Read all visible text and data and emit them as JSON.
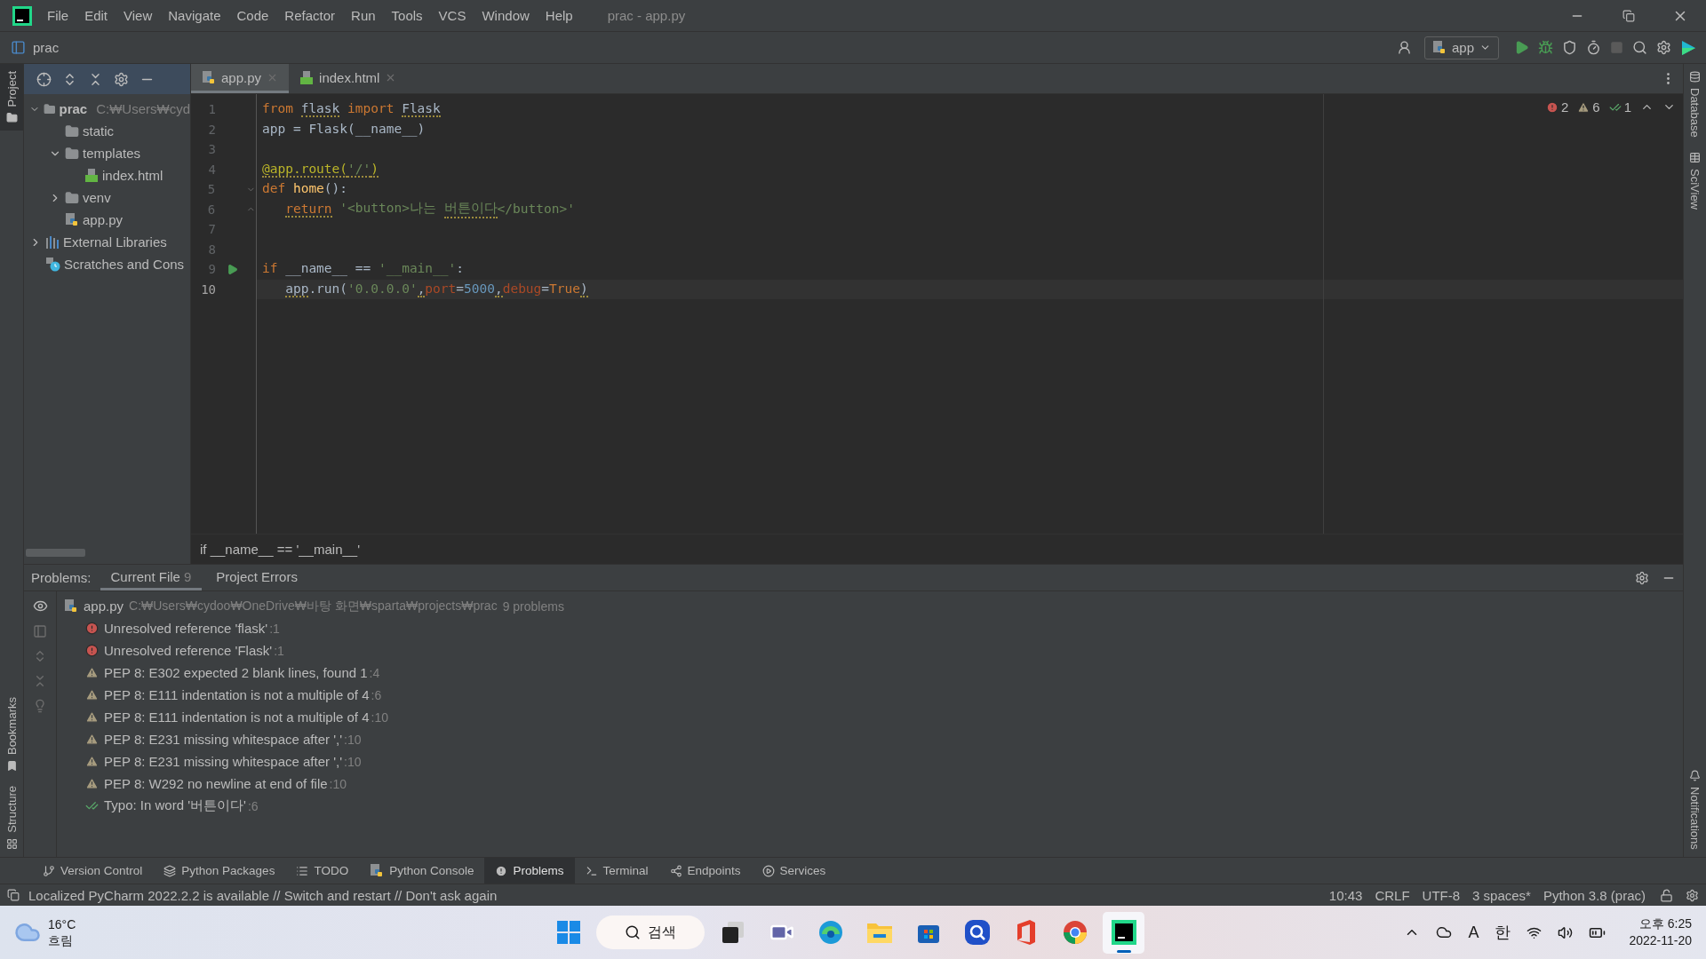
{
  "title_bar": {
    "menu": [
      "File",
      "Edit",
      "View",
      "Navigate",
      "Code",
      "Refactor",
      "Run",
      "Tools",
      "VCS",
      "Window",
      "Help"
    ],
    "title": "prac - app.py"
  },
  "nav_bar": {
    "breadcrumb": "prac",
    "run_config": "app"
  },
  "left_stripe": {
    "top": [
      {
        "label": "Project",
        "selected": true
      }
    ],
    "bottom": [
      {
        "label": "Bookmarks",
        "selected": false
      },
      {
        "label": "Structure",
        "selected": false
      }
    ]
  },
  "right_stripe": {
    "top": [
      {
        "label": "Database"
      },
      {
        "label": "SciView"
      }
    ],
    "bottom": [
      {
        "label": "Notifications"
      }
    ]
  },
  "project_tree": [
    {
      "name": "prac",
      "hint": "C:₩Users₩cyd",
      "kind": "root",
      "expanded": true,
      "children": [
        {
          "name": "static",
          "kind": "folder"
        },
        {
          "name": "templates",
          "kind": "folder",
          "expanded": true,
          "children": [
            {
              "name": "index.html",
              "kind": "html"
            }
          ]
        },
        {
          "name": "venv",
          "kind": "folder",
          "expanded": false
        },
        {
          "name": "app.py",
          "kind": "py"
        }
      ]
    },
    {
      "name": "External Libraries",
      "kind": "libraries",
      "expanded": false
    },
    {
      "name": "Scratches and Cons",
      "kind": "scratches"
    }
  ],
  "editor_tabs": [
    {
      "label": "app.py",
      "kind": "py",
      "selected": true
    },
    {
      "label": "index.html",
      "kind": "html",
      "selected": false
    }
  ],
  "inspections": {
    "errors": "2",
    "warnings": "6",
    "typos": "1"
  },
  "code_lines": [
    {
      "number": "1",
      "tokens": [
        {
          "t": "from ",
          "kind": "kw"
        },
        {
          "t": "flask",
          "kind": "plain",
          "flagged": true
        },
        {
          "t": " import ",
          "kind": "kw"
        },
        {
          "t": "Flask",
          "kind": "plain",
          "flagged": true
        }
      ]
    },
    {
      "number": "2",
      "tokens": [
        {
          "t": "app = Flask(__name__)",
          "kind": "plain"
        }
      ]
    },
    {
      "number": "3"
    },
    {
      "number": "4",
      "tokens": [
        {
          "t": "@app.route(",
          "kind": "deco",
          "flagged": true
        },
        {
          "t": "'/'",
          "kind": "str",
          "flagged": true
        },
        {
          "t": ")",
          "kind": "deco",
          "flagged": true
        }
      ]
    },
    {
      "number": "5",
      "fold_start": true,
      "tokens": [
        {
          "t": "def ",
          "kind": "kw"
        },
        {
          "t": "home",
          "kind": "fn"
        },
        {
          "t": "():",
          "kind": "plain"
        }
      ]
    },
    {
      "number": "6",
      "fold_end": true,
      "indent": true,
      "tokens": [
        {
          "t": "return",
          "kind": "kw",
          "flagged": true
        },
        {
          "t": " '<button>나는 ",
          "kind": "str"
        },
        {
          "t": "버튼이다",
          "kind": "str",
          "flagged": true
        },
        {
          "t": "</button>'",
          "kind": "str"
        }
      ]
    },
    {
      "number": "7"
    },
    {
      "number": "8"
    },
    {
      "number": "9",
      "run": true,
      "tokens": [
        {
          "t": "if ",
          "kind": "kw"
        },
        {
          "t": "__name__ == ",
          "kind": "plain"
        },
        {
          "t": "'__main__'",
          "kind": "str"
        },
        {
          "t": ":",
          "kind": "plain"
        }
      ]
    },
    {
      "number": "10",
      "current": true,
      "indent": true,
      "tokens": [
        {
          "t": "app",
          "kind": "plain",
          "flagged": true
        },
        {
          "t": ".run(",
          "kind": "plain"
        },
        {
          "t": "'0.0.0.0'",
          "kind": "str"
        },
        {
          "t": ",",
          "kind": "plain",
          "flagged": true
        },
        {
          "t": "port",
          "kind": "param"
        },
        {
          "t": "=",
          "kind": "plain"
        },
        {
          "t": "5000",
          "kind": "num"
        },
        {
          "t": ",",
          "kind": "plain",
          "flagged": true
        },
        {
          "t": "debug",
          "kind": "param"
        },
        {
          "t": "=",
          "kind": "plain"
        },
        {
          "t": "True",
          "kind": "kw"
        },
        {
          "t": ")",
          "kind": "plain",
          "flagged": true
        }
      ]
    }
  ],
  "editor_breadcrumb": "if __name__ == '__main__'",
  "problems": {
    "label": "Problems:",
    "tabs": [
      {
        "label": "Current File",
        "count": "9",
        "selected": true
      },
      {
        "label": "Project Errors",
        "selected": false
      }
    ],
    "file": {
      "name": "app.py",
      "path": "C:₩Users₩cydoo₩OneDrive₩바탕 화면₩sparta₩projects₩prac",
      "summary": "9 problems"
    },
    "items": [
      {
        "kind": "error",
        "text": "Unresolved reference 'flask'",
        "line": ":1"
      },
      {
        "kind": "error",
        "text": "Unresolved reference 'Flask'",
        "line": ":1"
      },
      {
        "kind": "warning",
        "text": "PEP 8: E302 expected 2 blank lines, found 1",
        "line": ":4"
      },
      {
        "kind": "warning",
        "text": "PEP 8: E111 indentation is not a multiple of 4",
        "line": ":6"
      },
      {
        "kind": "warning",
        "text": "PEP 8: E111 indentation is not a multiple of 4",
        "line": ":10"
      },
      {
        "kind": "warning",
        "text": "PEP 8: E231 missing whitespace after ','",
        "line": ":10"
      },
      {
        "kind": "warning",
        "text": "PEP 8: E231 missing whitespace after ','",
        "line": ":10"
      },
      {
        "kind": "warning",
        "text": "PEP 8: W292 no newline at end of file",
        "line": ":10"
      },
      {
        "kind": "typo",
        "text": "Typo: In word '버튼이다'",
        "line": ":6"
      }
    ]
  },
  "tool_windows": [
    {
      "label": "Version Control",
      "kind": "vcs",
      "selected": false
    },
    {
      "label": "Python Packages",
      "kind": "packages",
      "selected": false
    },
    {
      "label": "TODO",
      "kind": "todo",
      "selected": false
    },
    {
      "label": "Python Console",
      "kind": "console",
      "selected": false
    },
    {
      "label": "Problems",
      "kind": "problems",
      "selected": true
    },
    {
      "label": "Terminal",
      "kind": "terminal",
      "selected": false
    },
    {
      "label": "Endpoints",
      "kind": "endpoints",
      "selected": false
    },
    {
      "label": "Services",
      "kind": "services",
      "selected": false
    }
  ],
  "status_bar": {
    "message": "Localized PyCharm 2022.2.2 is available // Switch and restart // Don't ask again",
    "items": [
      "10:43",
      "CRLF",
      "UTF-8",
      "3 spaces*",
      "Python 3.8 (prac)"
    ]
  },
  "taskbar": {
    "weather": {
      "temp": "16°C",
      "condition": "흐림"
    },
    "search": "검색",
    "apps": [
      {
        "kind": "windows",
        "active": false
      },
      {
        "kind": "taskview",
        "active": false
      },
      {
        "kind": "chat",
        "active": false
      },
      {
        "kind": "edge",
        "active": false
      },
      {
        "kind": "explorer",
        "active": false
      },
      {
        "kind": "store",
        "active": false
      },
      {
        "kind": "lens",
        "active": false
      },
      {
        "kind": "office",
        "active": false
      },
      {
        "kind": "chrome",
        "active": false
      },
      {
        "kind": "pycharm",
        "active": true
      }
    ],
    "tray": [
      "A",
      "한"
    ],
    "time": "오후 6:25",
    "date": "2022-11-20"
  }
}
